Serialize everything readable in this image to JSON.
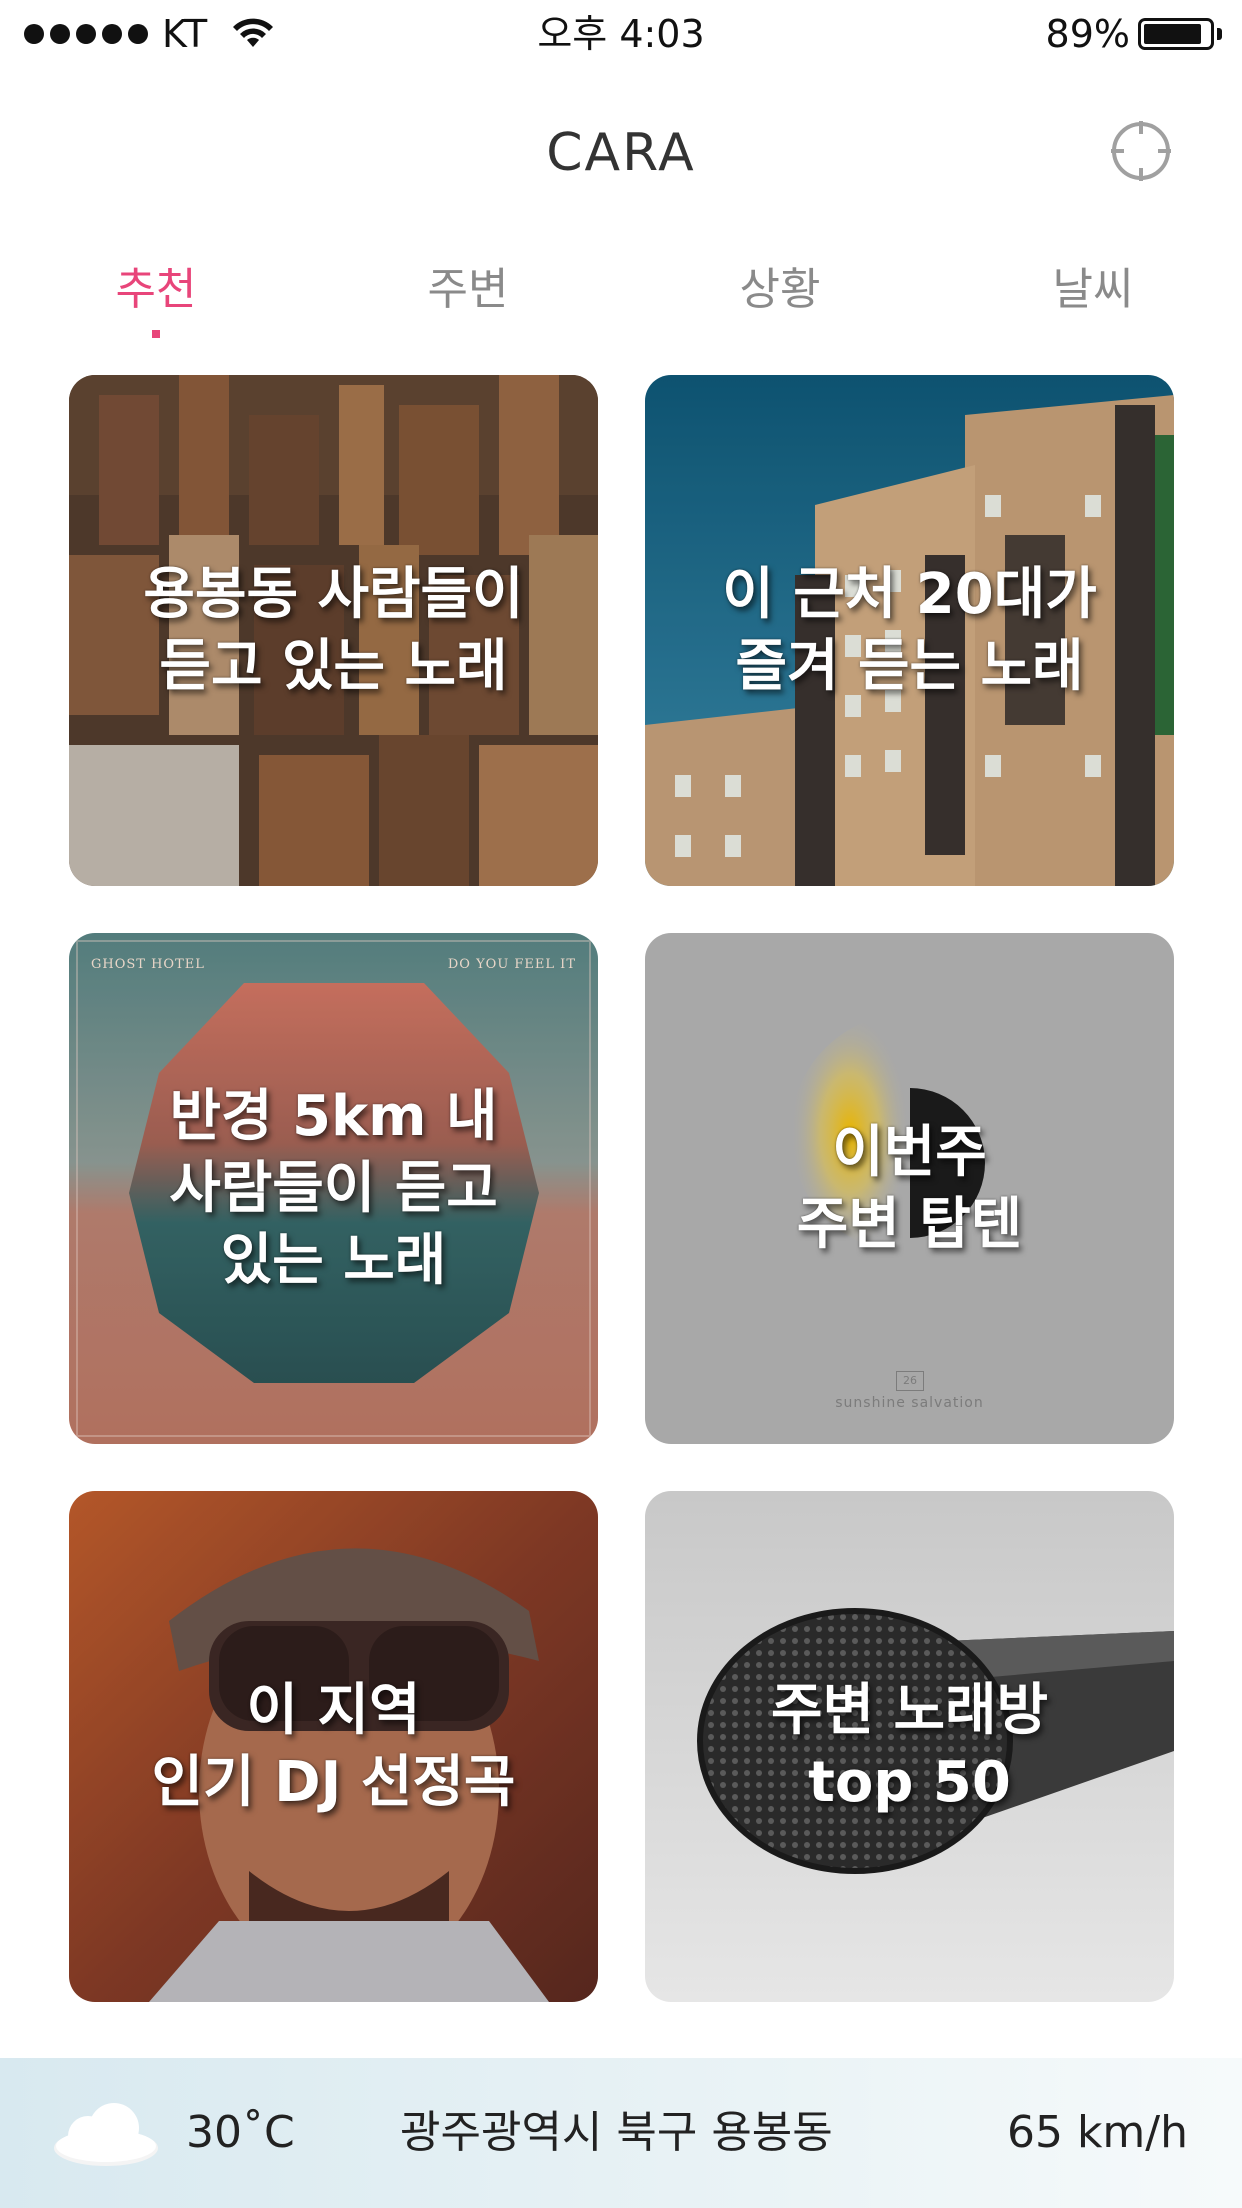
{
  "status_bar": {
    "carrier": "KT",
    "time": "오후 4:03",
    "battery": "89%",
    "battery_level": 0.89
  },
  "header": {
    "title": "CARA"
  },
  "tabs": [
    {
      "label": "추천",
      "active": true
    },
    {
      "label": "주변",
      "active": false
    },
    {
      "label": "상황",
      "active": false
    },
    {
      "label": "날씨",
      "active": false
    }
  ],
  "cards": [
    {
      "title": "용봉동 사람들이\n듣고 있는 노래",
      "image": "city-aerial"
    },
    {
      "title": "이 근처 20대가\n즐겨 듣는 노래",
      "image": "apartment-building"
    },
    {
      "title": "반경 5km 내\n사람들이 듣고\n있는 노래",
      "image": "ghost-hotel-album",
      "album_left": "GHOST HOTEL",
      "album_right": "DO YOU FEEL IT"
    },
    {
      "title": "이번주\n주변 탑텐",
      "image": "sunshine-salvation-album",
      "album_logo": "26",
      "album_name": "sunshine salvation"
    },
    {
      "title": "이 지역\n인기 DJ 선정곡",
      "image": "dj-portrait"
    },
    {
      "title": "주변 노래방\ntop 50",
      "image": "microphone"
    }
  ],
  "info_bar": {
    "weather_icon": "cloud-icon",
    "temperature": "30˚C",
    "location": "광주광역시 북구 용봉동",
    "speed": "65 km/h"
  },
  "colors": {
    "accent": "#e8457a",
    "tab_inactive": "#8a8a8a",
    "title_text": "#333333"
  }
}
